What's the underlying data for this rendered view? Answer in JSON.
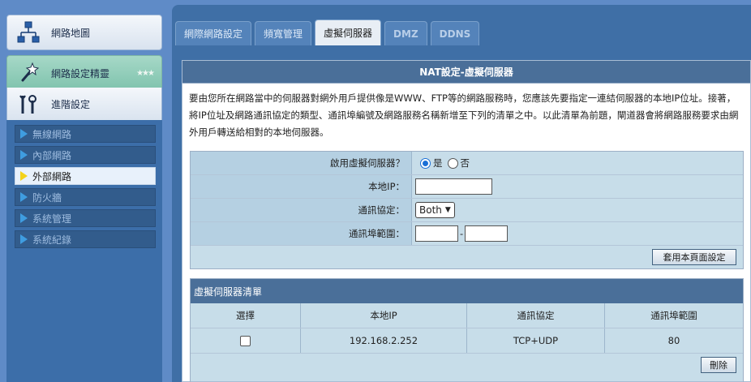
{
  "sidebar": {
    "main_items": [
      {
        "label": "網路地圖",
        "icon": "network-map-icon"
      },
      {
        "label": "網路設定精靈",
        "icon": "magic-wand-icon"
      },
      {
        "label": "進階設定",
        "icon": "tools-icon"
      }
    ],
    "submenu": [
      {
        "label": "無線網路"
      },
      {
        "label": "內部網路"
      },
      {
        "label": "外部網路"
      },
      {
        "label": "防火牆"
      },
      {
        "label": "系統管理"
      },
      {
        "label": "系統紀錄"
      }
    ]
  },
  "tabs": [
    {
      "label": "網際網路設定"
    },
    {
      "label": "頻寬管理"
    },
    {
      "label": "虛擬伺服器"
    },
    {
      "label": "DMZ"
    },
    {
      "label": "DDNS"
    }
  ],
  "content": {
    "title": "NAT設定-虛擬伺服器",
    "description": "要由您所在網路當中的伺服器對網外用戶提供像是WWW、FTP等的網路服務時，您應該先要指定一連結伺服器的本地IP位址。接著，將IP位址及網路通訊協定的類型、通訊埠編號及網路服務名稱新增至下列的清單之中。以此清單為前題，閘道器會將網路服務要求由網外用戶轉送給相對的本地伺服器。"
  },
  "form": {
    "enable_label": "啟用虛擬伺服器？",
    "yes_label": "是",
    "no_label": "否",
    "local_ip_label": "本地IP：",
    "protocol_label": "通訊協定：",
    "protocol_value": "Both",
    "port_range_label": "通訊埠範圍：",
    "port_separator": "-",
    "apply_button": "套用本頁面設定"
  },
  "list": {
    "title": "虛擬伺服器清單",
    "columns": [
      "選擇",
      "本地IP",
      "通訊協定",
      "通訊埠範圍"
    ],
    "rows": [
      {
        "local_ip": "192.168.2.252",
        "protocol": "TCP+UDP",
        "port_range": "80"
      }
    ],
    "delete_button": "刪除"
  }
}
